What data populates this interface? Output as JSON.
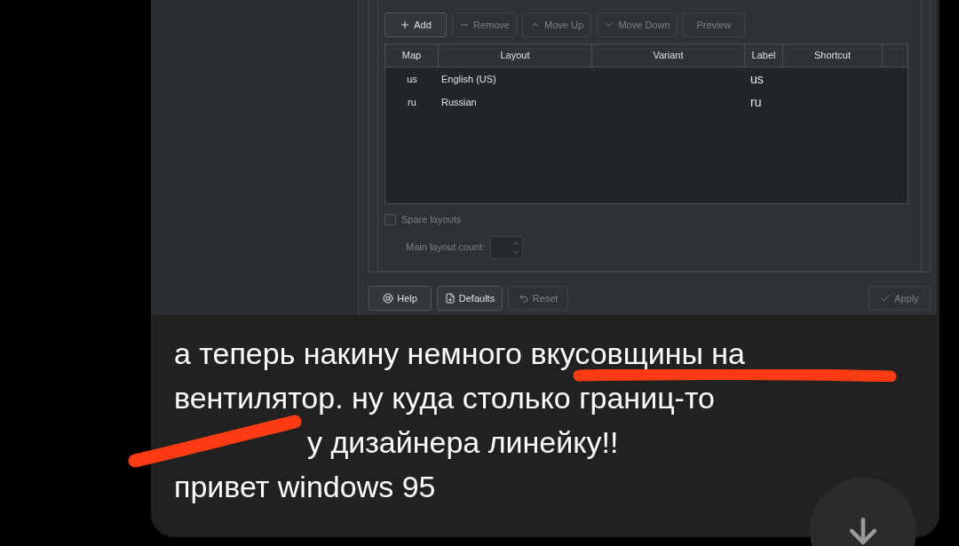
{
  "toolbar_buttons": [
    {
      "kind": "add",
      "label": "Add",
      "disabled": false
    },
    {
      "kind": "remove",
      "label": "Remove",
      "disabled": true
    },
    {
      "kind": "up",
      "label": "Move Up",
      "disabled": true
    },
    {
      "kind": "down",
      "label": "Move Down",
      "disabled": true
    },
    {
      "kind": "preview",
      "label": "Preview",
      "disabled": true
    }
  ],
  "table": {
    "columns": [
      "Map",
      "Layout",
      "Variant",
      "Label",
      "Shortcut"
    ],
    "rows": [
      {
        "map": "us",
        "layout": "English (US)",
        "label": "us"
      },
      {
        "map": "ru",
        "layout": "Russian",
        "label": "ru"
      }
    ]
  },
  "spare_layouts": {
    "label": "Spare layouts",
    "checked": false
  },
  "main_layout_count": {
    "label": "Main layout count:"
  },
  "footer_buttons": [
    {
      "kind": "help",
      "label": "Help",
      "disabled": false
    },
    {
      "kind": "defaults",
      "label": "Defaults",
      "disabled": false
    },
    {
      "kind": "reset",
      "label": "Reset",
      "disabled": true
    },
    {
      "kind": "apply",
      "label": "Apply",
      "disabled": true
    }
  ],
  "message": {
    "lines": [
      {
        "text": "а теперь накину немного вкусовщины на"
      },
      {
        "text": "вентилятор. ну куда столько границ-то"
      },
      {
        "text": "у дизайнера линейку!!",
        "starts_covered": true
      },
      {
        "text": "привет windows 95"
      }
    ]
  }
}
